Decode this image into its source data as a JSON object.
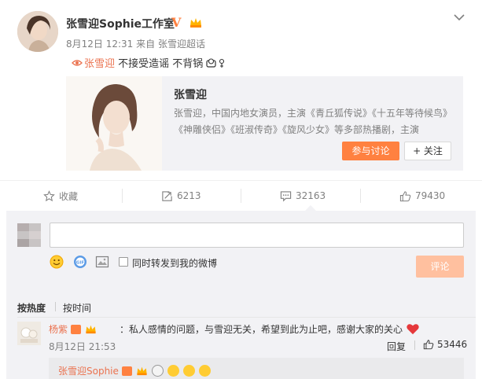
{
  "post": {
    "author": "张雪迎Sophie工作室",
    "time": "8月12日 12:31",
    "source": "来自 张雪迎超话",
    "topic": "张雪迎",
    "text": "不接受造谣 不背锅"
  },
  "card": {
    "title": "张雪迎",
    "description": "张雪迎，中国内地女演员，主演《青丘狐传说》《十五年等待候鸟》《神雕侠侣》《班淑传奇》《旋风少女》等多部热播剧，主演",
    "join_label": "参与讨论",
    "follow_label": "+ 关注"
  },
  "actions": {
    "favorite": "收藏",
    "repost": "6213",
    "comment": "32163",
    "like": "79430"
  },
  "composer": {
    "share_label": "同时转发到我的微博",
    "submit_label": "评论"
  },
  "sort": {
    "hot": "按热度",
    "time": "按时间"
  },
  "comment": {
    "user": "杨紫",
    "text": "：私人感情的问题，与雪迎无关，希望到此为止吧，感谢大家的关心",
    "time": "8月12日 21:53",
    "reply_label": "回复",
    "likes": "53446"
  },
  "reply": {
    "user": "张雪迎Sophie"
  },
  "colors": {
    "accent": "#ff8140",
    "link": "#eb7350",
    "bg_gray": "#f2f2f5"
  }
}
